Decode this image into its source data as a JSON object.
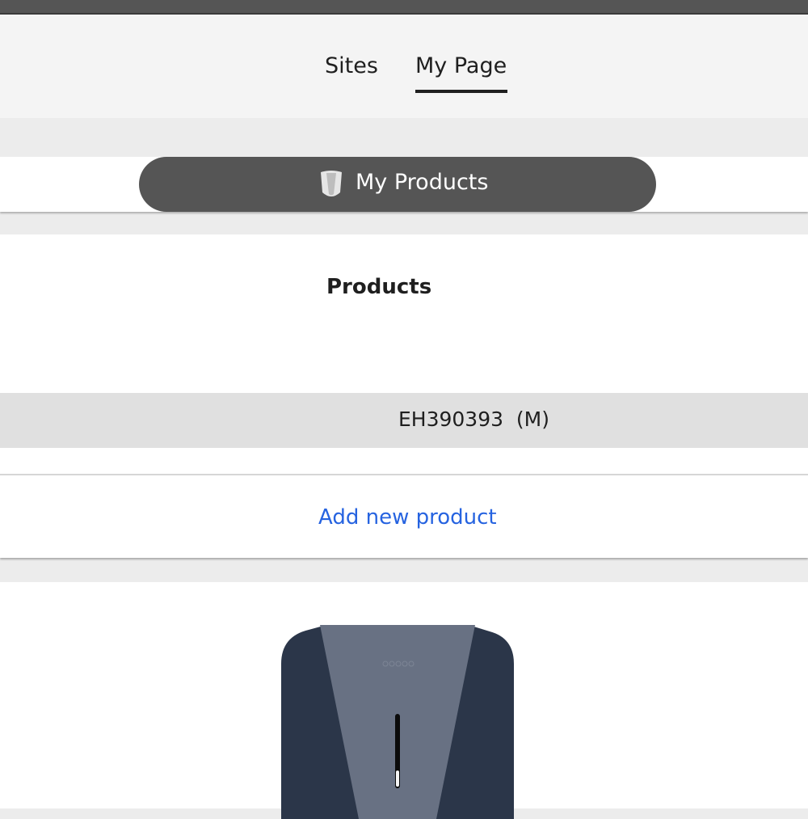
{
  "nav": {
    "tabs": [
      {
        "label": "Sites",
        "active": false
      },
      {
        "label": "My Page",
        "active": true
      }
    ]
  },
  "products_pill": {
    "label": "My Products",
    "icon": "charger-shield-icon"
  },
  "products_card": {
    "title": "Products",
    "items": [
      {
        "label": "EH390393  (M)"
      }
    ],
    "add_link": "Add new product"
  },
  "product_image": {
    "icon": "ev-charger-image"
  },
  "colors": {
    "topbar": "#555555",
    "pill": "#555555",
    "link": "#2663e0",
    "charger_body": "#2b3649",
    "charger_face": "#687183"
  }
}
